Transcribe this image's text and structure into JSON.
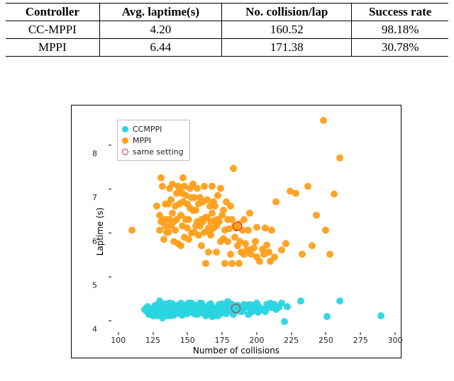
{
  "table": {
    "headers": [
      "Controller",
      "Avg. laptime(s)",
      "No. collision/lap",
      "Success rate"
    ],
    "rows": [
      {
        "controller": "CC-MPPI",
        "avg_laptime": "4.20",
        "collisions": "160.52",
        "success": "98.18%"
      },
      {
        "controller": "MPPI",
        "avg_laptime": "6.44",
        "collisions": "171.38",
        "success": "30.78%"
      }
    ]
  },
  "chart_data": {
    "type": "scatter",
    "xlabel": "Number of collisions",
    "ylabel": "Laptime (s)",
    "xlim": [
      95,
      300
    ],
    "ylim": [
      3.7,
      8.7
    ],
    "xticks": [
      100,
      125,
      150,
      175,
      200,
      225,
      250,
      275,
      300
    ],
    "yticks": [
      4,
      5,
      6,
      7,
      8
    ],
    "legend": {
      "entries": [
        {
          "name": "CCMPPI",
          "marker": "dot",
          "color": "#2ad4e0"
        },
        {
          "name": "MPPI",
          "marker": "dot",
          "color": "#ff9f1a"
        },
        {
          "name": "same setting",
          "marker": "ring",
          "color": "#e02020"
        }
      ]
    },
    "series": [
      {
        "name": "CCMPPI",
        "color": "#2ad4e0",
        "points": [
          [
            119,
            4.25
          ],
          [
            120,
            4.22
          ],
          [
            121,
            4.32
          ],
          [
            122,
            4.14
          ],
          [
            122,
            4.25
          ],
          [
            123,
            4.15
          ],
          [
            124,
            4.21
          ],
          [
            124,
            4.24
          ],
          [
            125,
            4.1
          ],
          [
            125,
            4.25
          ],
          [
            126,
            4.12
          ],
          [
            126,
            4.3
          ],
          [
            127,
            4.2
          ],
          [
            127,
            4.35
          ],
          [
            128,
            4.2
          ],
          [
            128,
            4.1
          ],
          [
            128,
            4.3
          ],
          [
            129,
            4.18
          ],
          [
            129,
            4.35
          ],
          [
            130,
            4.2
          ],
          [
            130,
            4.45
          ],
          [
            131,
            4.2
          ],
          [
            131,
            4.36
          ],
          [
            132,
            4.18
          ],
          [
            132,
            4.05
          ],
          [
            133,
            4.25
          ],
          [
            133,
            4.15
          ],
          [
            134,
            4.18
          ],
          [
            134,
            4.38
          ],
          [
            135,
            4.2
          ],
          [
            135,
            4.1
          ],
          [
            136,
            4.2
          ],
          [
            136,
            4.28
          ],
          [
            137,
            4.15
          ],
          [
            137,
            4.4
          ],
          [
            138,
            4.18
          ],
          [
            138,
            4.1
          ],
          [
            139,
            4.2
          ],
          [
            139,
            4.38
          ],
          [
            140,
            4.12
          ],
          [
            140,
            4.3
          ],
          [
            141,
            4.3
          ],
          [
            141,
            4.15
          ],
          [
            142,
            4.3
          ],
          [
            142,
            4.2
          ],
          [
            143,
            4.18
          ],
          [
            143,
            4.35
          ],
          [
            144,
            4.32
          ],
          [
            144,
            4.2
          ],
          [
            145,
            4.14
          ],
          [
            145,
            4.4
          ],
          [
            146,
            4.2
          ],
          [
            146,
            4.12
          ],
          [
            147,
            4.25
          ],
          [
            147,
            4.14
          ],
          [
            148,
            4.18
          ],
          [
            148,
            4.32
          ],
          [
            149,
            4.2
          ],
          [
            149,
            4.35
          ],
          [
            150,
            4.32
          ],
          [
            150,
            4.15
          ],
          [
            151,
            4.2
          ],
          [
            151,
            4.4
          ],
          [
            152,
            4.18
          ],
          [
            152,
            4.36
          ],
          [
            153,
            4.22
          ],
          [
            153,
            4.4
          ],
          [
            154,
            4.18
          ],
          [
            154,
            4.3
          ],
          [
            155,
            4.25
          ],
          [
            155,
            4.15
          ],
          [
            156,
            4.35
          ],
          [
            156,
            4.2
          ],
          [
            157,
            4.28
          ],
          [
            157,
            4.14
          ],
          [
            158,
            4.32
          ],
          [
            158,
            4.18
          ],
          [
            159,
            4.25
          ],
          [
            159,
            4.4
          ],
          [
            160,
            4.18
          ],
          [
            160,
            4.4
          ],
          [
            161,
            4.2
          ],
          [
            161,
            4.16
          ],
          [
            162,
            4.25
          ],
          [
            162,
            4.18
          ],
          [
            163,
            4.1
          ],
          [
            163,
            4.3
          ],
          [
            164,
            4.24
          ],
          [
            164,
            4.18
          ],
          [
            165,
            4.35
          ],
          [
            165,
            4.15
          ],
          [
            166,
            4.28
          ],
          [
            166,
            4.22
          ],
          [
            167,
            4.22
          ],
          [
            167,
            4.38
          ],
          [
            168,
            4.08
          ],
          [
            168,
            4.32
          ],
          [
            169,
            4.2
          ],
          [
            169,
            4.1
          ],
          [
            170,
            4.28
          ],
          [
            170,
            4.12
          ],
          [
            171,
            4.18
          ],
          [
            172,
            4.1
          ],
          [
            172,
            4.3
          ],
          [
            173,
            4.36
          ],
          [
            173,
            4.2
          ],
          [
            174,
            4.15
          ],
          [
            175,
            4.38
          ],
          [
            175,
            4.22
          ],
          [
            176,
            4.2
          ],
          [
            177,
            4.22
          ],
          [
            177,
            4.35
          ],
          [
            178,
            4.15
          ],
          [
            178,
            4.28
          ],
          [
            179,
            4.42
          ],
          [
            180,
            4.3
          ],
          [
            180,
            4.22
          ],
          [
            181,
            4.38
          ],
          [
            182,
            4.36
          ],
          [
            183,
            4.14
          ],
          [
            183,
            4.35
          ],
          [
            184,
            4.26
          ],
          [
            184,
            4.22
          ],
          [
            185,
            4.28
          ],
          [
            186,
            4.35
          ],
          [
            186,
            4.22
          ],
          [
            187,
            4.3
          ],
          [
            188,
            4.28
          ],
          [
            189,
            4.2
          ],
          [
            190,
            4.22
          ],
          [
            191,
            4.36
          ],
          [
            192,
            4.3
          ],
          [
            193,
            4.35
          ],
          [
            194,
            4.14
          ],
          [
            194,
            4.3
          ],
          [
            195,
            4.36
          ],
          [
            196,
            4.32
          ],
          [
            196,
            4.18
          ],
          [
            197,
            4.24
          ],
          [
            198,
            4.35
          ],
          [
            199,
            4.3
          ],
          [
            200,
            4.22
          ],
          [
            200,
            4.4
          ],
          [
            201,
            4.18
          ],
          [
            202,
            4.3
          ],
          [
            204,
            4.25
          ],
          [
            206,
            4.2
          ],
          [
            207,
            4.36
          ],
          [
            209,
            4.3
          ],
          [
            210,
            4.4
          ],
          [
            211,
            4.3
          ],
          [
            213,
            4.36
          ],
          [
            214,
            4.25
          ],
          [
            216,
            4.3
          ],
          [
            218,
            4.4
          ],
          [
            220,
            3.98
          ],
          [
            222,
            4.32
          ],
          [
            232,
            4.45
          ],
          [
            251,
            4.08
          ],
          [
            260,
            4.45
          ],
          [
            290,
            4.1
          ]
        ]
      },
      {
        "name": "MPPI",
        "color": "#ff9f1a",
        "points": [
          [
            110,
            6.05
          ],
          [
            128,
            6.6
          ],
          [
            130,
            6.05
          ],
          [
            130,
            6.4
          ],
          [
            131,
            6.25
          ],
          [
            131,
            7.25
          ],
          [
            132,
            6.3
          ],
          [
            132,
            7.05
          ],
          [
            133,
            5.85
          ],
          [
            134,
            6.15
          ],
          [
            134,
            6.65
          ],
          [
            135,
            6.0
          ],
          [
            135,
            6.3
          ],
          [
            136,
            6.65
          ],
          [
            136,
            6.0
          ],
          [
            137,
            7.0
          ],
          [
            137,
            6.3
          ],
          [
            138,
            6.15
          ],
          [
            138,
            6.75
          ],
          [
            139,
            6.45
          ],
          [
            139,
            7.1
          ],
          [
            140,
            6.25
          ],
          [
            140,
            5.8
          ],
          [
            141,
            6.05
          ],
          [
            141,
            6.6
          ],
          [
            142,
            6.9
          ],
          [
            142,
            6.3
          ],
          [
            143,
            5.75
          ],
          [
            143,
            7.05
          ],
          [
            144,
            6.65
          ],
          [
            144,
            6.95
          ],
          [
            145,
            5.7
          ],
          [
            145,
            6.4
          ],
          [
            146,
            6.9
          ],
          [
            146,
            6.15
          ],
          [
            147,
            6.7
          ],
          [
            147,
            7.25
          ],
          [
            148,
            5.9
          ],
          [
            148,
            7.05
          ],
          [
            149,
            6.3
          ],
          [
            149,
            6.85
          ],
          [
            150,
            6.65
          ],
          [
            150,
            6.1
          ],
          [
            151,
            5.85
          ],
          [
            151,
            6.3
          ],
          [
            152,
            6.55
          ],
          [
            152,
            7.0
          ],
          [
            153,
            5.99
          ],
          [
            153,
            6.8
          ],
          [
            154,
            6.5
          ],
          [
            154,
            7.1
          ],
          [
            155,
            6.0
          ],
          [
            155,
            6.8
          ],
          [
            156,
            6.15
          ],
          [
            156,
            6.5
          ],
          [
            157,
            7.0
          ],
          [
            157,
            6.25
          ],
          [
            158,
            5.95
          ],
          [
            158,
            6.65
          ],
          [
            159,
            6.8
          ],
          [
            159,
            6.15
          ],
          [
            160,
            5.7
          ],
          [
            160,
            6.3
          ],
          [
            161,
            6.7
          ],
          [
            161,
            6.25
          ],
          [
            162,
            7.05
          ],
          [
            162,
            6.0
          ],
          [
            163,
            6.35
          ],
          [
            163,
            5.3
          ],
          [
            164,
            6.75
          ],
          [
            164,
            6.35
          ],
          [
            165,
            6.1
          ],
          [
            165,
            5.55
          ],
          [
            166,
            6.0
          ],
          [
            166,
            6.6
          ],
          [
            167,
            5.95
          ],
          [
            167,
            6.25
          ],
          [
            168,
            7.05
          ],
          [
            168,
            6.45
          ],
          [
            169,
            6.1
          ],
          [
            169,
            6.7
          ],
          [
            170,
            6.28
          ],
          [
            170,
            6.6
          ],
          [
            171,
            5.55
          ],
          [
            171,
            6.15
          ],
          [
            172,
            6.3
          ],
          [
            172,
            6.85
          ],
          [
            173,
            6.25
          ],
          [
            174,
            5.8
          ],
          [
            174,
            7.0
          ],
          [
            175,
            6.4
          ],
          [
            176,
            5.86
          ],
          [
            176,
            6.5
          ],
          [
            177,
            5.3
          ],
          [
            177,
            6.05
          ],
          [
            178,
            6.7
          ],
          [
            179,
            5.8
          ],
          [
            179,
            6.3
          ],
          [
            180,
            6.08
          ],
          [
            181,
            5.5
          ],
          [
            181,
            6.6
          ],
          [
            182,
            5.3
          ],
          [
            182,
            6.3
          ],
          [
            183,
            7.46
          ],
          [
            184,
            6.15
          ],
          [
            184,
            5.9
          ],
          [
            185,
            6.1
          ],
          [
            185,
            6.1
          ],
          [
            186,
            5.7
          ],
          [
            187,
            6.2
          ],
          [
            187,
            5.3
          ],
          [
            188,
            5.8
          ],
          [
            189,
            5.55
          ],
          [
            190,
            6.05
          ],
          [
            191,
            5.5
          ],
          [
            191,
            6.3
          ],
          [
            192,
            5.75
          ],
          [
            193,
            5.6
          ],
          [
            194,
            6.05
          ],
          [
            195,
            5.6
          ],
          [
            195,
            6.45
          ],
          [
            196,
            5.5
          ],
          [
            198,
            5.65
          ],
          [
            199,
            5.8
          ],
          [
            200,
            5.45
          ],
          [
            200,
            6.12
          ],
          [
            202,
            5.35
          ],
          [
            204,
            5.62
          ],
          [
            205,
            5.5
          ],
          [
            206,
            6.1
          ],
          [
            207,
            5.72
          ],
          [
            209,
            5.55
          ],
          [
            210,
            5.35
          ],
          [
            211,
            6.05
          ],
          [
            214,
            6.7
          ],
          [
            213,
            5.45
          ],
          [
            218,
            5.6
          ],
          [
            221,
            5.75
          ],
          [
            224,
            6.95
          ],
          [
            228,
            6.9
          ],
          [
            233,
            5.5
          ],
          [
            237,
            7.05
          ],
          [
            240,
            5.7
          ],
          [
            243,
            6.4
          ],
          [
            248,
            8.55
          ],
          [
            253,
            5.5
          ],
          [
            256,
            6.88
          ],
          [
            260,
            7.7
          ],
          [
            250,
            6.05
          ]
        ]
      }
    ],
    "marked": [
      {
        "x": 186,
        "y": 6.13
      },
      {
        "x": 185,
        "y": 4.26
      }
    ]
  }
}
